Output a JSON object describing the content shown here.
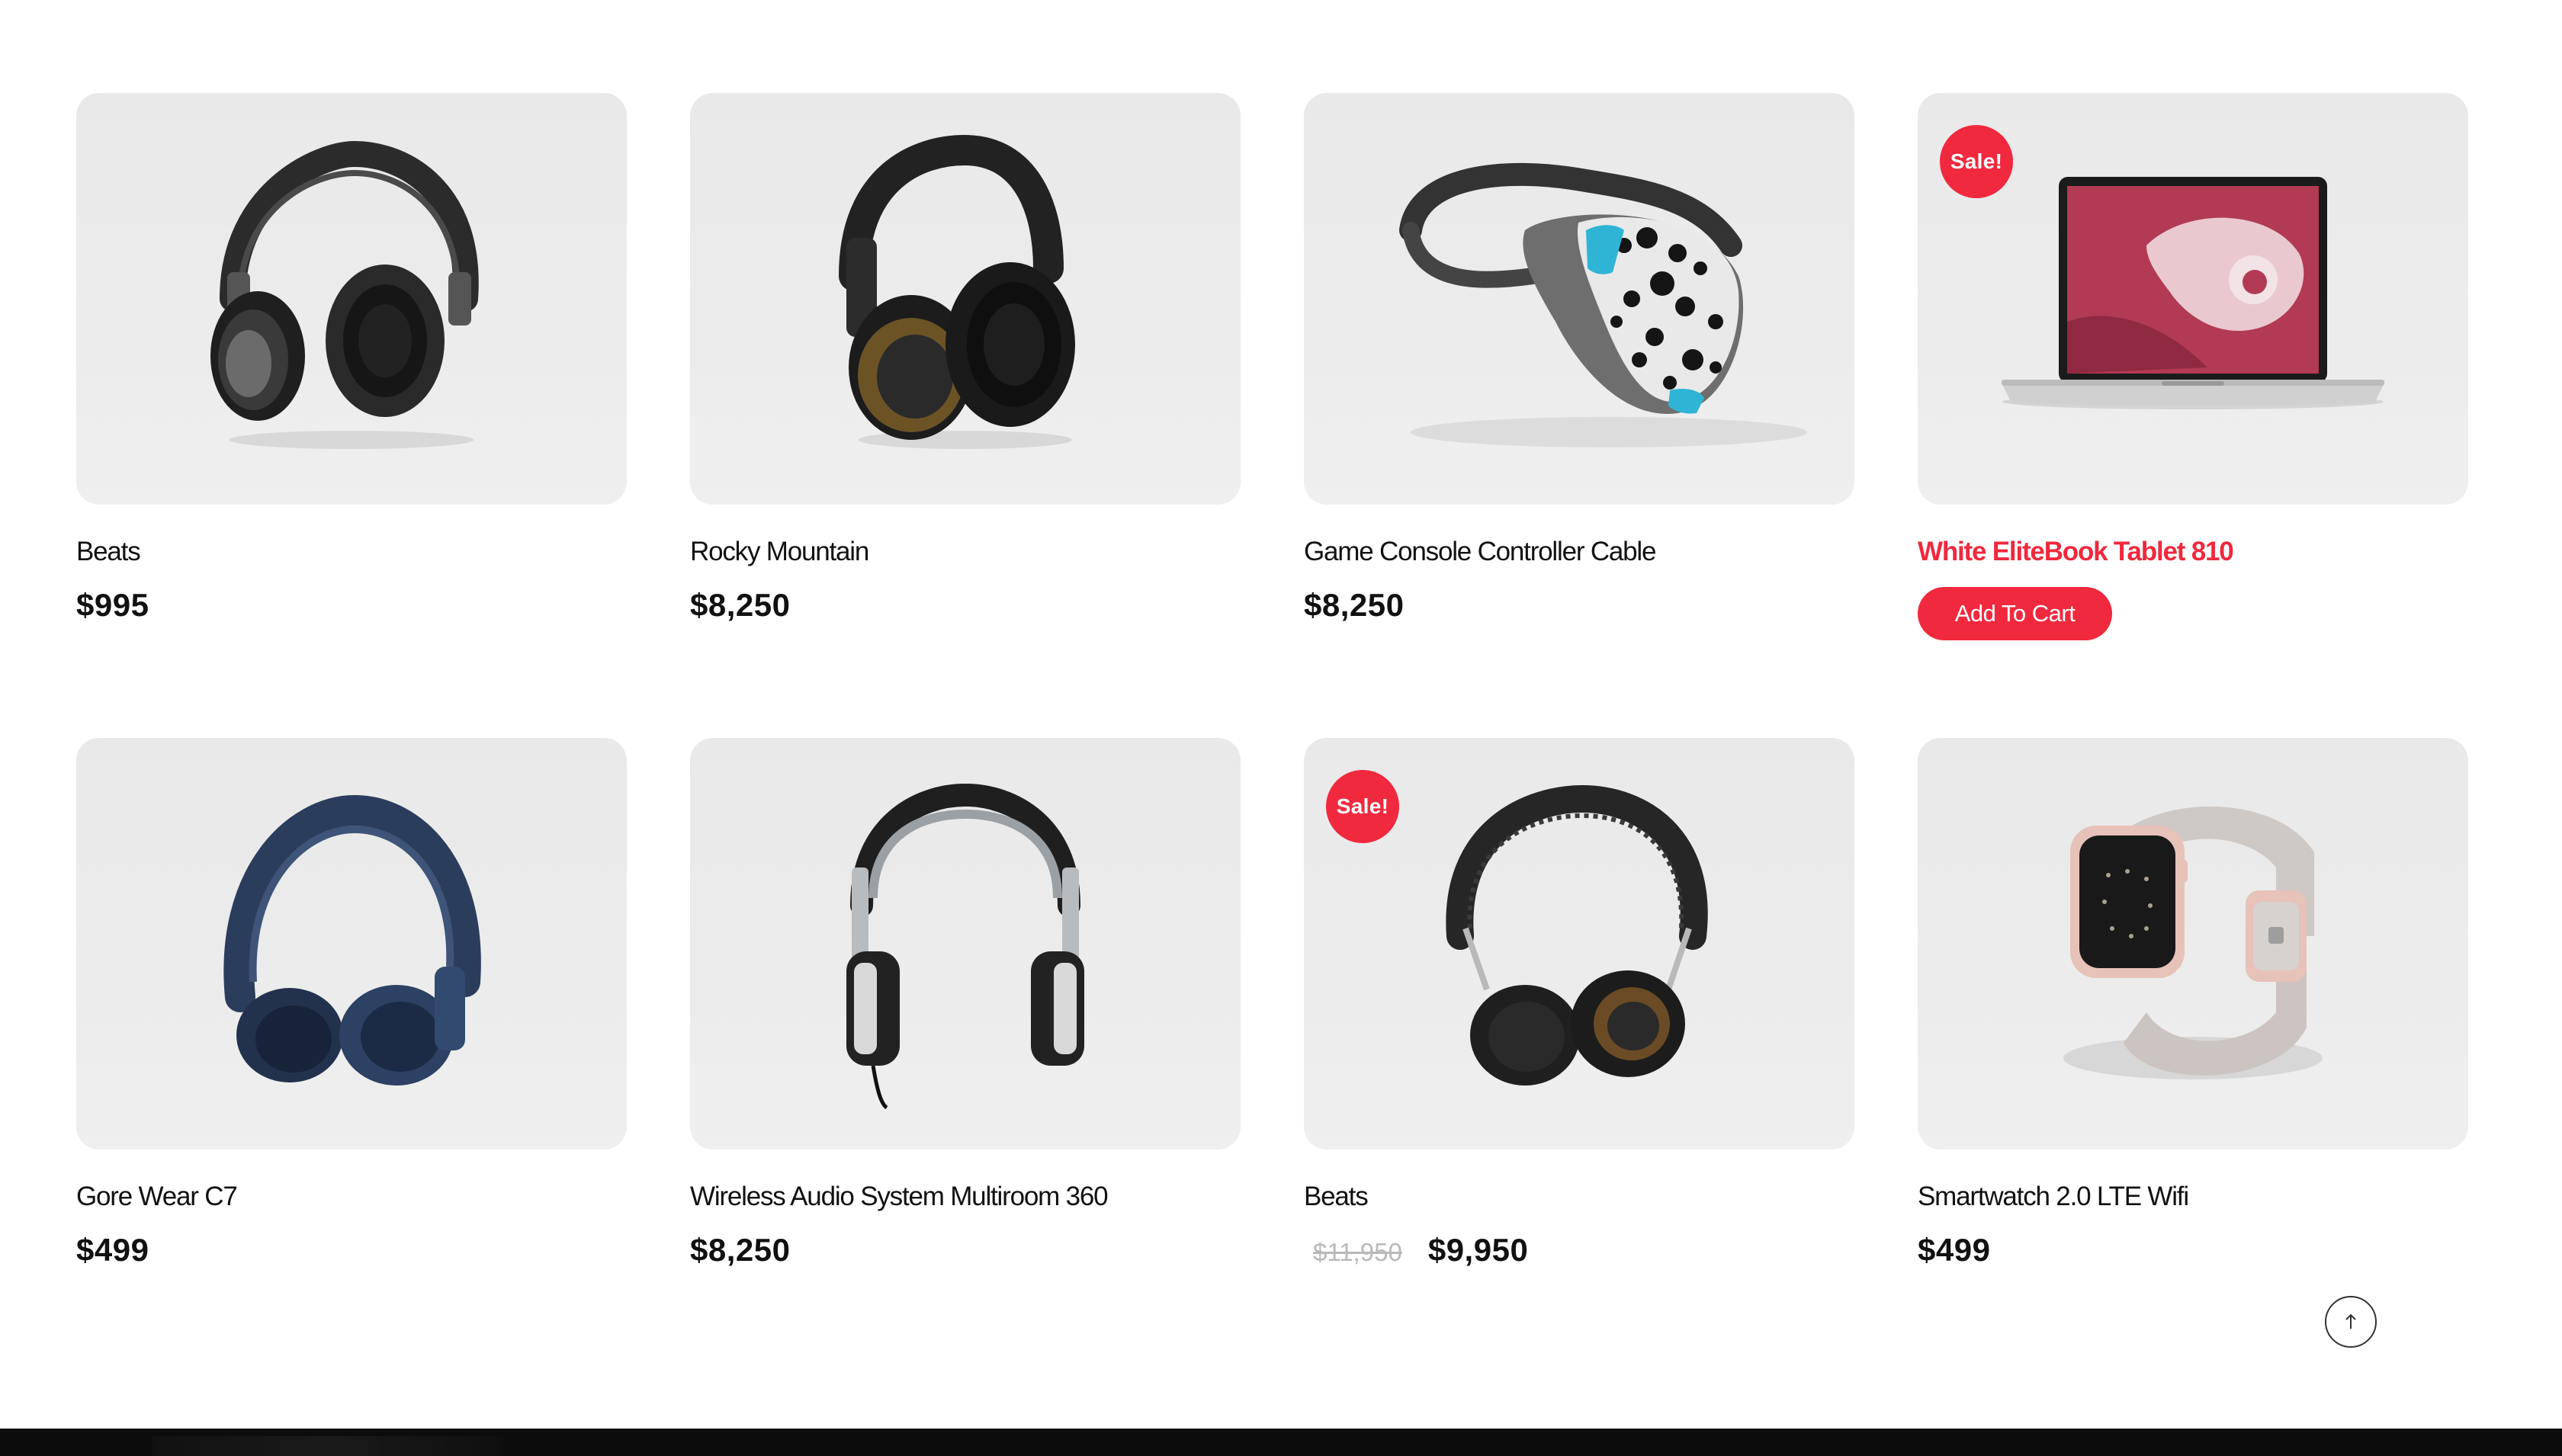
{
  "products": [
    {
      "name": "Beats",
      "price": "$995",
      "image_icon": "black-headphones-icon",
      "sale": false
    },
    {
      "name": "Rocky Mountain",
      "price": "$8,250",
      "image_icon": "gold-black-headphones-icon",
      "sale": false
    },
    {
      "name": "Game Console Controller Cable",
      "price": "$8,250",
      "image_icon": "vr-headset-icon",
      "sale": false
    },
    {
      "name": "White EliteBook Tablet 810",
      "sale_label": "Sale!",
      "cart_label": "Add To Cart",
      "image_icon": "laptop-icon",
      "sale": true
    },
    {
      "name": "Gore Wear C7",
      "price": "$499",
      "image_icon": "blue-headphones-icon",
      "sale": false
    },
    {
      "name": "Wireless Audio System Multiroom 360",
      "price": "$8,250",
      "image_icon": "silver-dj-headphones-icon",
      "sale": false
    },
    {
      "name": "Beats",
      "old_price": "$11,950",
      "price": "$9,950",
      "sale_label": "Sale!",
      "image_icon": "leather-headphones-icon",
      "sale": true
    },
    {
      "name": "Smartwatch 2.0 LTE Wifi",
      "price": "$499",
      "image_icon": "smartwatch-icon",
      "sale": false
    }
  ],
  "scroll_top": {
    "icon": "arrow-up-icon"
  },
  "colors": {
    "accent": "#f0293e",
    "card_bg": "#ececec",
    "text": "#111111",
    "muted": "#b9b9b9",
    "footer": "#0c0c0c"
  }
}
